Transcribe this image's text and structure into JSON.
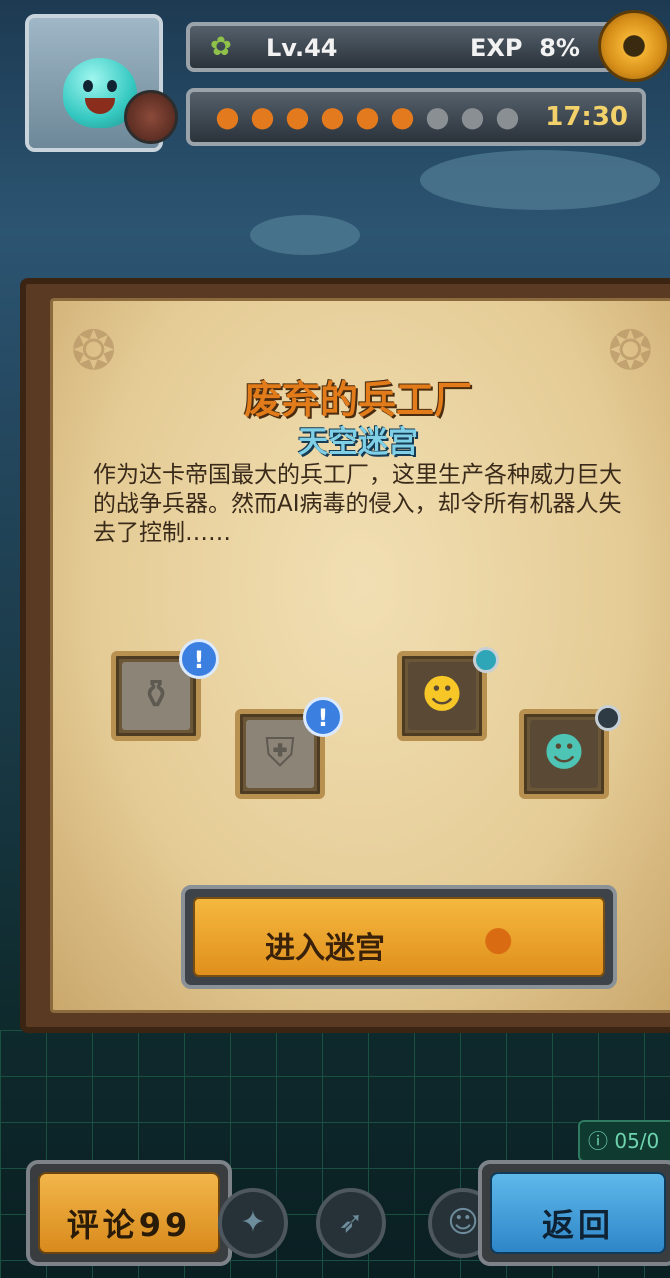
{
  "header": {
    "level": "Lv.44",
    "exp_label": "EXP",
    "exp_value": "8%",
    "timer": "17:30",
    "stamina": {
      "filled": 6,
      "total": 9
    }
  },
  "panel": {
    "title": "废弃的兵工厂",
    "subtitle": "天空迷宫",
    "description": "作为达卡帝国最大的兵工厂，这里生产各种威力巨大的战争兵器。然而AI病毒的侵入，却令所有机器人失去了控制……",
    "enter_button": "进入迷宫"
  },
  "slots": {
    "mark": "!"
  },
  "counter": "05/0",
  "bottom": {
    "review_button": "评论99",
    "back_button": "返回"
  },
  "icons": [
    "settings-gear-icon",
    "carrot-icon",
    "vase-icon",
    "shield-icon",
    "robot-hero-icon",
    "warrior-hero-icon",
    "rocket-icon"
  ],
  "colors": {
    "accent": "#e0901c",
    "title": "#e27b1a",
    "subtitle": "#7fd0e6",
    "back_button": "#2e86c8"
  }
}
